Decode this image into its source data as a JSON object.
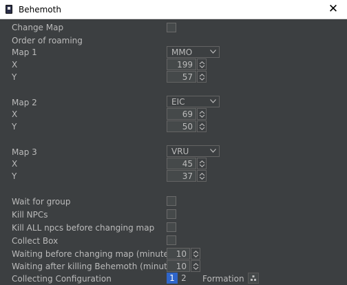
{
  "window": {
    "title": "Behemoth"
  },
  "labels": {
    "change_map": "Change Map",
    "order_of_roaming": "Order of roaming",
    "map1": "Map 1",
    "map2": "Map 2",
    "map3": "Map 3",
    "x": "X",
    "y": "Y",
    "wait_for_group": "Wait for group",
    "kill_npcs": "Kill NPCs",
    "kill_all_npcs": "Kill ALL npcs before changing map",
    "collect_box": "Collect Box",
    "waiting_before": "Waiting before changing map (minutes)",
    "waiting_after": "Waiting after killing Behemoth (minutes)",
    "collecting_config": "Collecting Configuration",
    "formation": "Formation"
  },
  "maps": [
    {
      "selected": "MMO",
      "x": "199",
      "y": "57"
    },
    {
      "selected": "EIC",
      "x": "69",
      "y": "50"
    },
    {
      "selected": "VRU",
      "x": "45",
      "y": "37"
    }
  ],
  "checkboxes": {
    "change_map": false,
    "wait_for_group": false,
    "kill_npcs": false,
    "kill_all_npcs": false,
    "collect_box": false
  },
  "waiting": {
    "before_minutes": "10",
    "after_minutes": "10"
  },
  "collecting": {
    "options": [
      "1",
      "2"
    ],
    "selected": "1"
  },
  "colors": {
    "background": "#3c3f41",
    "accent": "#2f65ca",
    "text": "#bbbbbb"
  }
}
